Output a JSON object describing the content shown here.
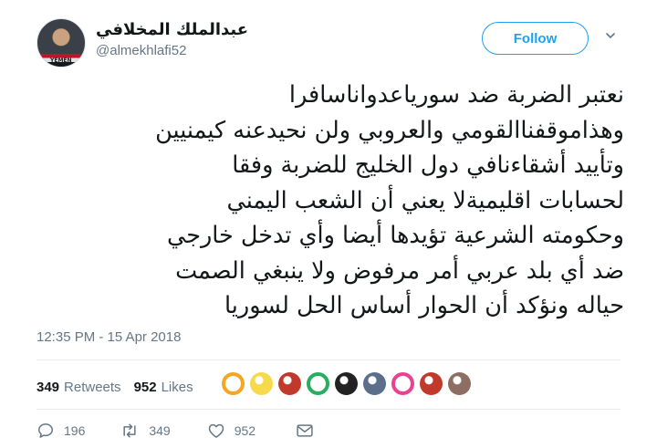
{
  "user": {
    "display_name": "عبدالملك المخلافي",
    "handle": "@almekhlafi52",
    "avatar_flag_text": "YEMEN"
  },
  "follow_label": "Follow",
  "tweet_lines": [
    "نعتبر الضربة ضد سورياعدواناسافرا",
    "وهذاموقفناالقومي والعروبي ولن نحيدعنه كيمنيين",
    "وتأييد أشقاءنافي دول الخليج للضربة وفقا",
    "لحسابات اقليميةلا يعني أن الشعب اليمني",
    "وحكومته الشرعية تؤيدها أيضا وأي تدخل خارجي",
    "ضد أي بلد عربي أمر مرفوض ولا ينبغي الصمت",
    "حياله ونؤكد أن الحوار أساس الحل لسوريا"
  ],
  "timestamp": "12:35 PM - 15 Apr 2018",
  "stats": {
    "retweets_count": "349",
    "retweets_label": "Retweets",
    "likes_count": "952",
    "likes_label": "Likes"
  },
  "liker_avatars": [
    {
      "name": "liker-1",
      "color": "#f5a623"
    },
    {
      "name": "liker-2",
      "color": "#f7d94c"
    },
    {
      "name": "liker-3",
      "color": "#c0392b"
    },
    {
      "name": "liker-4",
      "color": "#27ae60"
    },
    {
      "name": "liker-5",
      "color": "#222222"
    },
    {
      "name": "liker-6",
      "color": "#5b6f8a"
    },
    {
      "name": "liker-7",
      "color": "#e84393"
    },
    {
      "name": "liker-8",
      "color": "#c0392b"
    },
    {
      "name": "liker-9",
      "color": "#8d6e63"
    }
  ],
  "actions": {
    "replies": "196",
    "retweets": "349",
    "likes": "952"
  },
  "colors": {
    "accent": "#1da1f2",
    "secondary_text": "#657786",
    "primary_text": "#14171a"
  }
}
